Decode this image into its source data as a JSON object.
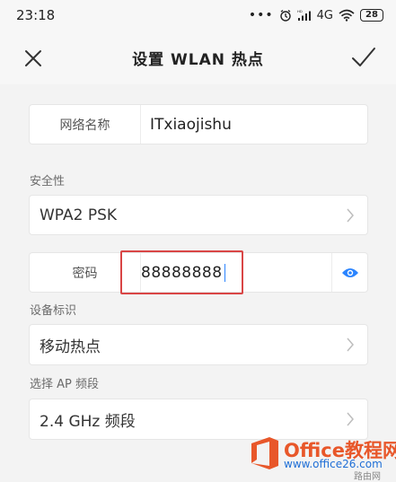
{
  "status_bar": {
    "time": "23:18",
    "dots": "•••",
    "network": "4G",
    "hd_label": "HD",
    "battery": "28"
  },
  "header": {
    "title": "设置 WLAN 热点",
    "close_icon": "close-icon",
    "confirm_icon": "checkmark-icon"
  },
  "network_name": {
    "label": "网络名称",
    "value": "ITxiaojishu"
  },
  "security": {
    "section_label": "安全性",
    "value": "WPA2 PSK"
  },
  "password": {
    "label": "密码",
    "value": "88888888",
    "icon": "eye-icon",
    "highlight_color": "#d94545"
  },
  "device_id": {
    "section_label": "设备标识",
    "value": "移动热点"
  },
  "ap_band": {
    "section_label": "选择 AP 频段",
    "value": "2.4 GHz 频段"
  },
  "watermark": {
    "brand": "Office教程网",
    "url": "www.office26.com",
    "sub": "路由网"
  },
  "colors": {
    "accent": "#2a84ff",
    "highlight": "#d94545",
    "watermark_brand": "#e8572a"
  }
}
